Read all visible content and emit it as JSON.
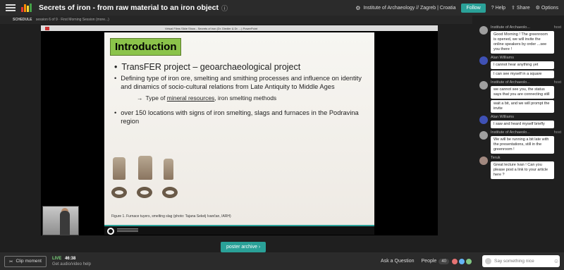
{
  "header": {
    "title": "Secrets of iron - from raw material to an iron object",
    "organizer": "Institute of Archaeology // Zagreb | Croatia",
    "follow_label": "Follow",
    "help_label": "Help",
    "share_label": "Share",
    "options_label": "Options"
  },
  "schedule": {
    "label": "SCHEDULE",
    "detail": "session 6 of 9 · First Morning Session (more...)"
  },
  "window_bar": {
    "title": "Virtual Films Slide Show - Secrets of iron (Dr. Diedler & Dr. ...) PowerPoint"
  },
  "slide": {
    "heading": "Introduction",
    "bullet1": "TransFER project – geoarchaeological project",
    "bullet2": "Defining type of iron ore, smelting and smithing processes and influence on identity and dinamics of socio-cultural relations from Late Antiquity to Middle Ages",
    "sub_arrow": "→",
    "sub_prefix": "Type of ",
    "sub_link": "mineral resources",
    "sub_suffix": ", iron smelting methods",
    "bullet3": "over 150 locations with signs of iron smelting, slags and furnaces in the Podravina region",
    "caption": "Figure 1. Furnace tuyers, smelting slag (photo: Tajana Sekelj Ivančan, IARH)"
  },
  "poster_button": "poster archive ›",
  "bottombar": {
    "clip_label": "Clip moment",
    "live_label": "LIVE",
    "time": "46:38",
    "audio_help": "Get audio/video help",
    "ask_label": "Ask a Question",
    "people_label": "People",
    "people_count": "40",
    "chat_placeholder": "Say something nice"
  },
  "chat": [
    {
      "name": "Institute of Archaeolo...",
      "badge": "host",
      "avatar_color": "#9e9e9e",
      "messages": [
        "Good Morning ! The greenroom is opened, we will invite the online speakers by order ...see you there !"
      ]
    },
    {
      "name": "Alan Williams",
      "badge": "",
      "avatar_color": "#3f51b5",
      "messages": [
        "I cannot hear anything yet",
        "I can see myself in a square"
      ]
    },
    {
      "name": "Institute of Archaeolo...",
      "badge": "host",
      "avatar_color": "#9e9e9e",
      "messages": [
        "we cannot see you, the status says that you are connecting still",
        "wait a bit, and we will prompt the invite"
      ]
    },
    {
      "name": "Alan Williams",
      "badge": "",
      "avatar_color": "#3f51b5",
      "messages": [
        "I saw and heard myself briefly"
      ]
    },
    {
      "name": "Institute of Archaeolo...",
      "badge": "host",
      "avatar_color": "#9e9e9e",
      "messages": [
        "We will be running a bit late with the presentations, still in the greenroom !"
      ]
    },
    {
      "name": "Teruk",
      "badge": "",
      "avatar_color": "#a1887f",
      "messages": [
        "Great lecture Ivan ! Can you please post a link to your article here ?"
      ]
    }
  ]
}
